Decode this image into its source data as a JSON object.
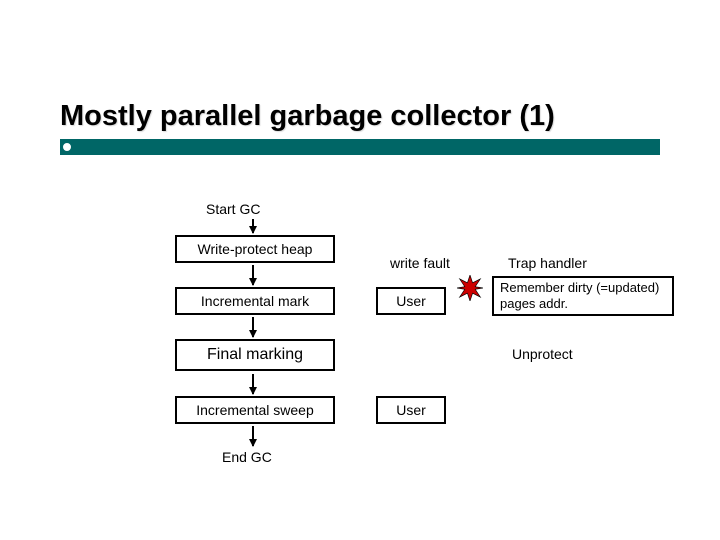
{
  "title": "Mostly parallel garbage collector (1)",
  "flow": {
    "start": "Start GC",
    "write_protect": "Write-protect heap",
    "incremental_mark": "Incremental mark",
    "final_marking": "Final marking",
    "incremental_sweep": "Incremental sweep",
    "end": "End GC"
  },
  "side": {
    "user1": "User",
    "user2": "User",
    "write_fault": "write fault",
    "trap_handler": "Trap handler",
    "remember": "Remember dirty (=updated) pages addr.",
    "unprotect": "Unprotect"
  },
  "colors": {
    "accent": "#006666",
    "star": "#cc0000"
  }
}
